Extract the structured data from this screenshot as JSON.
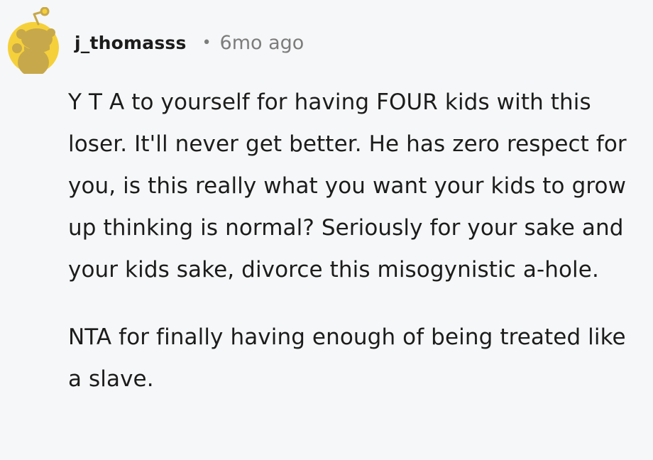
{
  "comment": {
    "username": "j_thomasss",
    "separator": "•",
    "timestamp": "6mo ago",
    "paragraphs": [
      "Y T A to yourself for having FOUR kids with this loser. It'll never get better. He has zero respect for you, is this really what you want your kids to grow up thinking is normal? Seriously for your sake and your kids sake, divorce this misogynistic a-hole.",
      "NTA for finally having enough of being treated like a slave."
    ]
  },
  "avatar": {
    "icon": "snoo-avatar-icon",
    "background_color": "#f5d03a",
    "figure_color": "#c7a84a"
  }
}
